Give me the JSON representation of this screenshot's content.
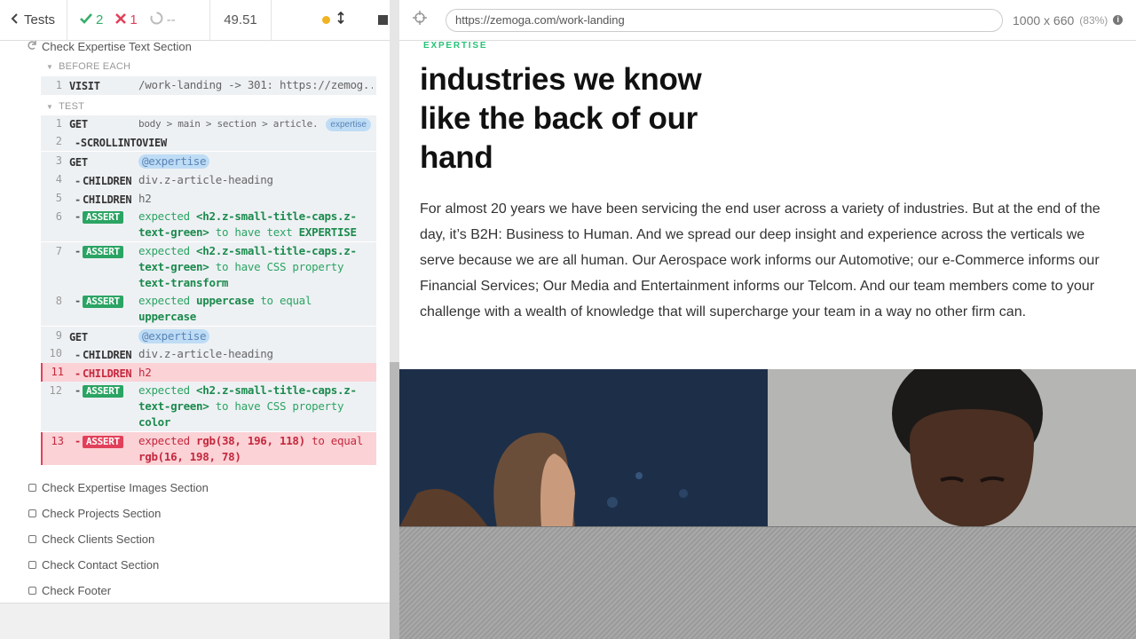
{
  "reporter": {
    "header": {
      "tests_label": "Tests",
      "passed": "2",
      "failed": "1",
      "pending": "--",
      "duration": "49.51"
    },
    "suite_title": "Check Expertise Text Section",
    "before_each_label": "BEFORE EACH",
    "test_label": "TEST",
    "before_each": [
      {
        "num": "1",
        "name": "VISIT",
        "msg": "/work-landing -> 301: https://zemog..."
      }
    ],
    "commands": [
      {
        "num": "1",
        "name": "GET",
        "msg": "body > main > section > article...",
        "alias": "expertise"
      },
      {
        "num": "2",
        "name": "-SCROLLINTOVIEW",
        "msg": ""
      },
      {
        "num": "3",
        "name": "GET",
        "alias": "@expertise"
      },
      {
        "num": "4",
        "name": "CHILDREN",
        "msg": "div.z-article-heading"
      },
      {
        "num": "5",
        "name": "CHILDREN",
        "msg": "h2"
      },
      {
        "num": "6",
        "name": "ASSERT",
        "msg_parts": [
          "expected",
          "<h2.z-small-title-caps.z-text-green>",
          "to have text",
          "EXPERTISE"
        ]
      },
      {
        "num": "7",
        "name": "ASSERT",
        "msg_parts": [
          "expected",
          "<h2.z-small-title-caps.z-text-green>",
          "to have CSS property",
          "text-transform"
        ]
      },
      {
        "num": "8",
        "name": "ASSERT",
        "msg_parts": [
          "expected",
          "uppercase",
          "to equal",
          "uppercase"
        ]
      },
      {
        "num": "9",
        "name": "GET",
        "alias": "@expertise"
      },
      {
        "num": "10",
        "name": "CHILDREN",
        "msg": "div.z-article-heading"
      },
      {
        "num": "11",
        "name": "CHILDREN",
        "msg": "h2"
      },
      {
        "num": "12",
        "name": "ASSERT",
        "msg_parts": [
          "expected",
          "<h2.z-small-title-caps.z-text-green>",
          "to have CSS property",
          "color"
        ]
      },
      {
        "num": "13",
        "name": "ASSERT",
        "msg_parts": [
          "expected",
          "rgb(38, 196, 118)",
          "to equal",
          "rgb(16, 198, 78)"
        ]
      }
    ],
    "other_tests": [
      "Check Expertise Images Section",
      "Check Projects Section",
      "Check Clients Section",
      "Check Contact Section",
      "Check Footer"
    ]
  },
  "aut": {
    "url": "https://zemoga.com/work-landing",
    "viewport": "1000 x 660",
    "scale": "(83%)",
    "page": {
      "eyebrow": "EXPERTISE",
      "heading": "industries we know like the back of our hand",
      "paragraph": "For almost 20 years we have been servicing the end user across a variety of industries. But at the end of the day, it’s B2H: Business to Human. And we spread our deep insight and experience across the verticals we serve because we are all human. Our Aerospace work informs our Automotive; our e-Commerce informs our Financial Services; Our Media and Entertainment informs our Telcom. And our team members come to your challenge with a wealth of knowledge that will supercharge your team in a way no other firm can."
    }
  },
  "colors": {
    "pass": "#36ad6a",
    "fail": "#e2405a",
    "accent_green": "#26c476",
    "alias_blue": "#bedcf5"
  },
  "icons": {
    "back": "chevron-left-icon",
    "pass": "check-icon",
    "fail": "x-icon",
    "pending": "circle-notch-icon",
    "running": "status-dot-icon",
    "autoscroll": "arrows-vertical-icon",
    "stop": "stop-icon",
    "selector": "crosshair-icon",
    "info": "info-icon"
  }
}
